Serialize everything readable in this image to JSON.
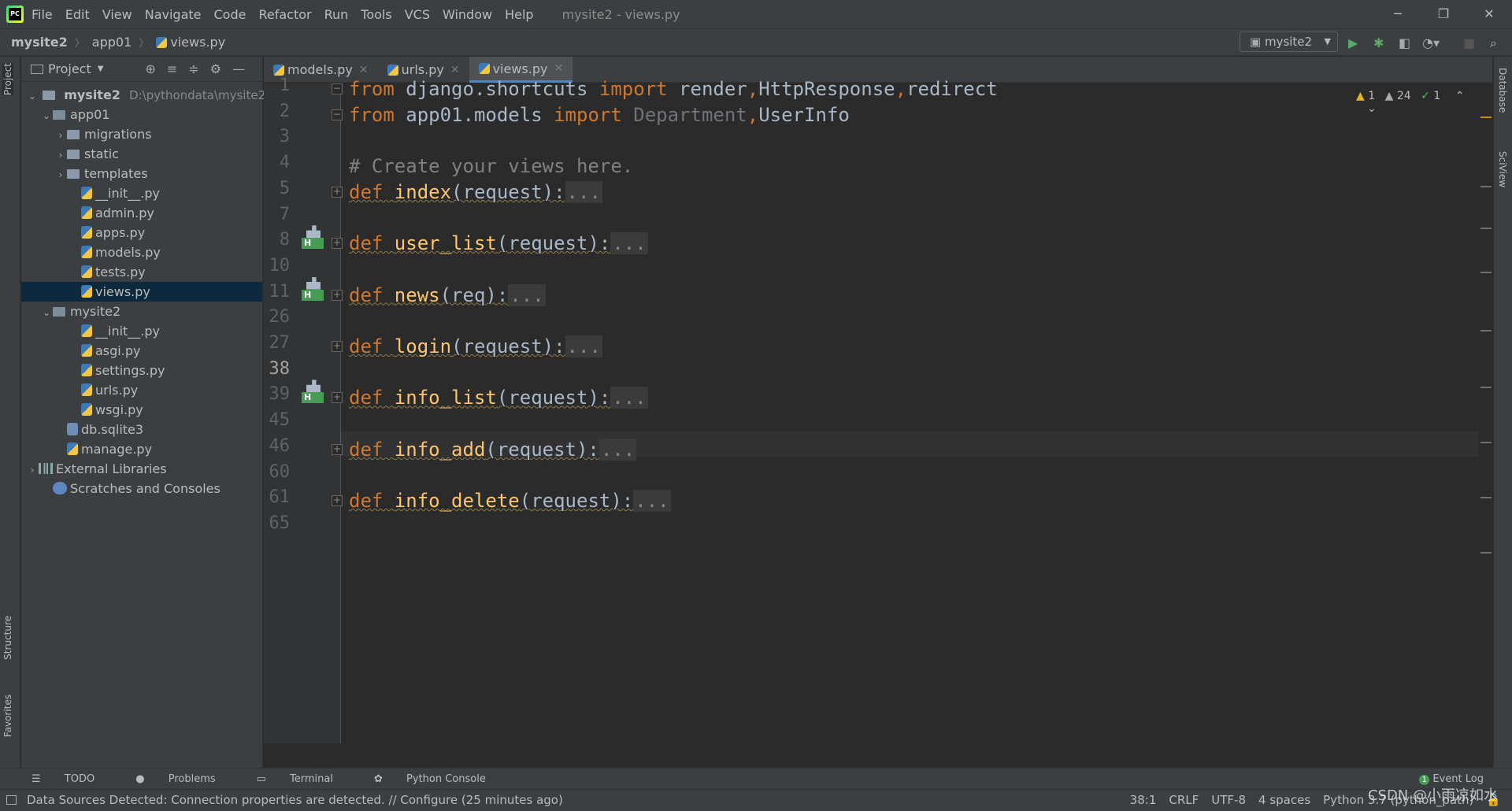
{
  "titlebar": {
    "menu": [
      "File",
      "Edit",
      "View",
      "Navigate",
      "Code",
      "Refactor",
      "Run",
      "Tools",
      "VCS",
      "Window",
      "Help"
    ],
    "window_title": "mysite2 - views.py",
    "controls": [
      "─",
      "❐",
      "✕"
    ]
  },
  "navbar": {
    "crumbs": [
      "mysite2",
      "app01",
      "views.py"
    ],
    "run_config": "mysite2"
  },
  "left_strip": {
    "project": "Project",
    "structure": "Structure",
    "favorites": "Favorites"
  },
  "right_strip": {
    "database": "Database",
    "sciview": "SciView"
  },
  "project_panel": {
    "title": "Project",
    "root": {
      "name": "mysite2",
      "path": "D:\\pythondata\\mysite2"
    },
    "items": [
      {
        "label": "app01",
        "indent": 1,
        "kind": "module",
        "arrow": "⌄"
      },
      {
        "label": "migrations",
        "indent": 2,
        "kind": "folder",
        "arrow": "›"
      },
      {
        "label": "static",
        "indent": 2,
        "kind": "folder",
        "arrow": "›"
      },
      {
        "label": "templates",
        "indent": 2,
        "kind": "folder",
        "arrow": "›"
      },
      {
        "label": "__init__.py",
        "indent": 3,
        "kind": "py"
      },
      {
        "label": "admin.py",
        "indent": 3,
        "kind": "py"
      },
      {
        "label": "apps.py",
        "indent": 3,
        "kind": "py"
      },
      {
        "label": "models.py",
        "indent": 3,
        "kind": "py"
      },
      {
        "label": "tests.py",
        "indent": 3,
        "kind": "py"
      },
      {
        "label": "views.py",
        "indent": 3,
        "kind": "py",
        "selected": true
      },
      {
        "label": "mysite2",
        "indent": 1,
        "kind": "module",
        "arrow": "⌄"
      },
      {
        "label": "__init__.py",
        "indent": 3,
        "kind": "py"
      },
      {
        "label": "asgi.py",
        "indent": 3,
        "kind": "py"
      },
      {
        "label": "settings.py",
        "indent": 3,
        "kind": "py"
      },
      {
        "label": "urls.py",
        "indent": 3,
        "kind": "py"
      },
      {
        "label": "wsgi.py",
        "indent": 3,
        "kind": "py"
      },
      {
        "label": "db.sqlite3",
        "indent": 2,
        "kind": "db"
      },
      {
        "label": "manage.py",
        "indent": 2,
        "kind": "py"
      },
      {
        "label": "External Libraries",
        "indent": 0,
        "kind": "lib",
        "arrow": "›"
      },
      {
        "label": "Scratches and Consoles",
        "indent": 1,
        "kind": "scratch"
      }
    ]
  },
  "tabs": [
    {
      "label": "models.py",
      "active": false
    },
    {
      "label": "urls.py",
      "active": false
    },
    {
      "label": "views.py",
      "active": true
    }
  ],
  "inspections": {
    "errors": "1",
    "warnings": "24",
    "weak": "1"
  },
  "editor": {
    "lines": [
      {
        "n": "1",
        "tokens": [
          [
            "kw",
            "from"
          ],
          [
            "plain",
            " django.shortcuts "
          ],
          [
            "kw",
            "import"
          ],
          [
            "plain",
            " render"
          ],
          [
            "kw",
            ","
          ],
          [
            "plain",
            "HttpResponse"
          ],
          [
            "kw",
            ","
          ],
          [
            "plain",
            "redirect"
          ]
        ]
      },
      {
        "n": "2",
        "tokens": [
          [
            "kw",
            "from"
          ],
          [
            "plain",
            " app01.models "
          ],
          [
            "kw",
            "import"
          ],
          [
            "gr",
            " Department"
          ],
          [
            "kw",
            ","
          ],
          [
            "plain",
            "UserInfo"
          ]
        ]
      },
      {
        "n": "3",
        "tokens": []
      },
      {
        "n": "4",
        "tokens": [
          [
            "cm",
            "# Create your views here."
          ]
        ]
      },
      {
        "n": "5",
        "tokens": [
          [
            "kw",
            "def "
          ],
          [
            "fn",
            "index"
          ],
          [
            "plain",
            "(request):"
          ],
          [
            "ell",
            "..."
          ]
        ],
        "fold": true
      },
      {
        "n": "7",
        "tokens": []
      },
      {
        "n": "8",
        "tokens": [
          [
            "kw",
            "def "
          ],
          [
            "fn",
            "user_list"
          ],
          [
            "plain",
            "(request):"
          ],
          [
            "ell",
            "..."
          ]
        ],
        "fold": true,
        "marker": true
      },
      {
        "n": "10",
        "tokens": []
      },
      {
        "n": "11",
        "tokens": [
          [
            "kw",
            "def "
          ],
          [
            "fn",
            "news"
          ],
          [
            "plain",
            "(req):"
          ],
          [
            "ell",
            "..."
          ]
        ],
        "fold": true,
        "marker": true
      },
      {
        "n": "26",
        "tokens": []
      },
      {
        "n": "27",
        "tokens": [
          [
            "kw",
            "def "
          ],
          [
            "fn",
            "login"
          ],
          [
            "plain",
            "(request):"
          ],
          [
            "ell",
            "..."
          ]
        ],
        "fold": true
      },
      {
        "n": "38",
        "tokens": [],
        "current": true
      },
      {
        "n": "39",
        "tokens": [
          [
            "kw",
            "def "
          ],
          [
            "fn",
            "info_list"
          ],
          [
            "plain",
            "(request):"
          ],
          [
            "ell",
            "..."
          ]
        ],
        "fold": true,
        "marker": true
      },
      {
        "n": "45",
        "tokens": []
      },
      {
        "n": "46",
        "tokens": [
          [
            "kw",
            "def "
          ],
          [
            "fn",
            "info_add"
          ],
          [
            "plain",
            "(request):"
          ],
          [
            "ell",
            "..."
          ]
        ],
        "fold": true
      },
      {
        "n": "60",
        "tokens": []
      },
      {
        "n": "61",
        "tokens": [
          [
            "kw",
            "def "
          ],
          [
            "fn",
            "info_delete"
          ],
          [
            "plain",
            "(request):"
          ],
          [
            "ell",
            "..."
          ]
        ],
        "fold": true
      },
      {
        "n": "65",
        "tokens": []
      }
    ]
  },
  "bottom_tools": [
    "TODO",
    "Problems",
    "Terminal",
    "Python Console"
  ],
  "event_log": {
    "count": "1",
    "label": "Event Log"
  },
  "status": {
    "message": "Data Sources Detected: Connection properties are detected. // Configure (25 minutes ago)",
    "position": "38:1",
    "line_sep": "CRLF",
    "encoding": "UTF-8",
    "indent": "4 spaces",
    "interpreter": "Python 3.7 (python_path)"
  },
  "watermark": "CSDN @小雨凉如水",
  "colors": {
    "keyword": "#cc7832",
    "function": "#ffc66d",
    "comment": "#808080",
    "selection": "#0d293e",
    "accent": "#4a88c7"
  }
}
